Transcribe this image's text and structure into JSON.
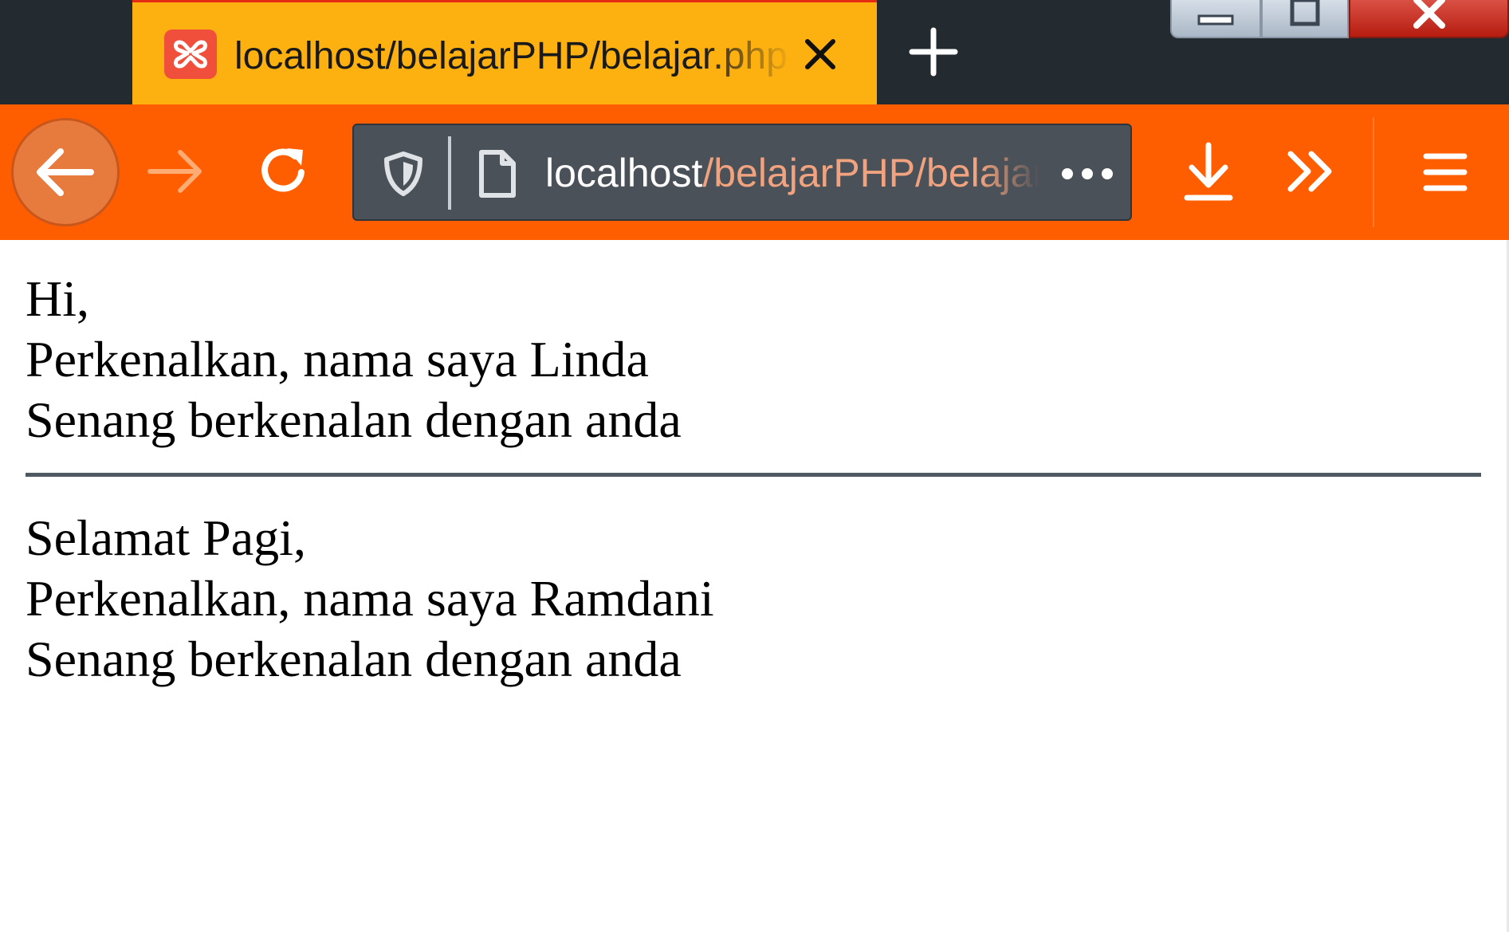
{
  "tab": {
    "title": "localhost/belajarPHP/belajar.php",
    "favicon": "xampp-icon"
  },
  "urlbar": {
    "host": "localhost",
    "path": "/belajarPHP/belajar.php"
  },
  "icons": {
    "back": "arrow-left-icon",
    "forward": "arrow-right-icon",
    "reload": "reload-icon",
    "shield": "shield-icon",
    "page": "page-icon",
    "page_actions": "ellipsis-icon",
    "downloads": "download-icon",
    "overflow": "chevron-double-right-icon",
    "menu": "hamburger-icon",
    "new_tab": "plus-icon",
    "close_tab": "close-icon"
  },
  "colors": {
    "tab_active": "#fdb111",
    "toolbar": "#ff5e00",
    "tabstrip": "#232a30",
    "urlbar": "#4b5158"
  },
  "content": {
    "block1": [
      "Hi,",
      "Perkenalkan, nama saya Linda",
      "Senang berkenalan dengan anda"
    ],
    "block2": [
      "Selamat Pagi,",
      "Perkenalkan, nama saya Ramdani",
      "Senang berkenalan dengan anda"
    ]
  }
}
